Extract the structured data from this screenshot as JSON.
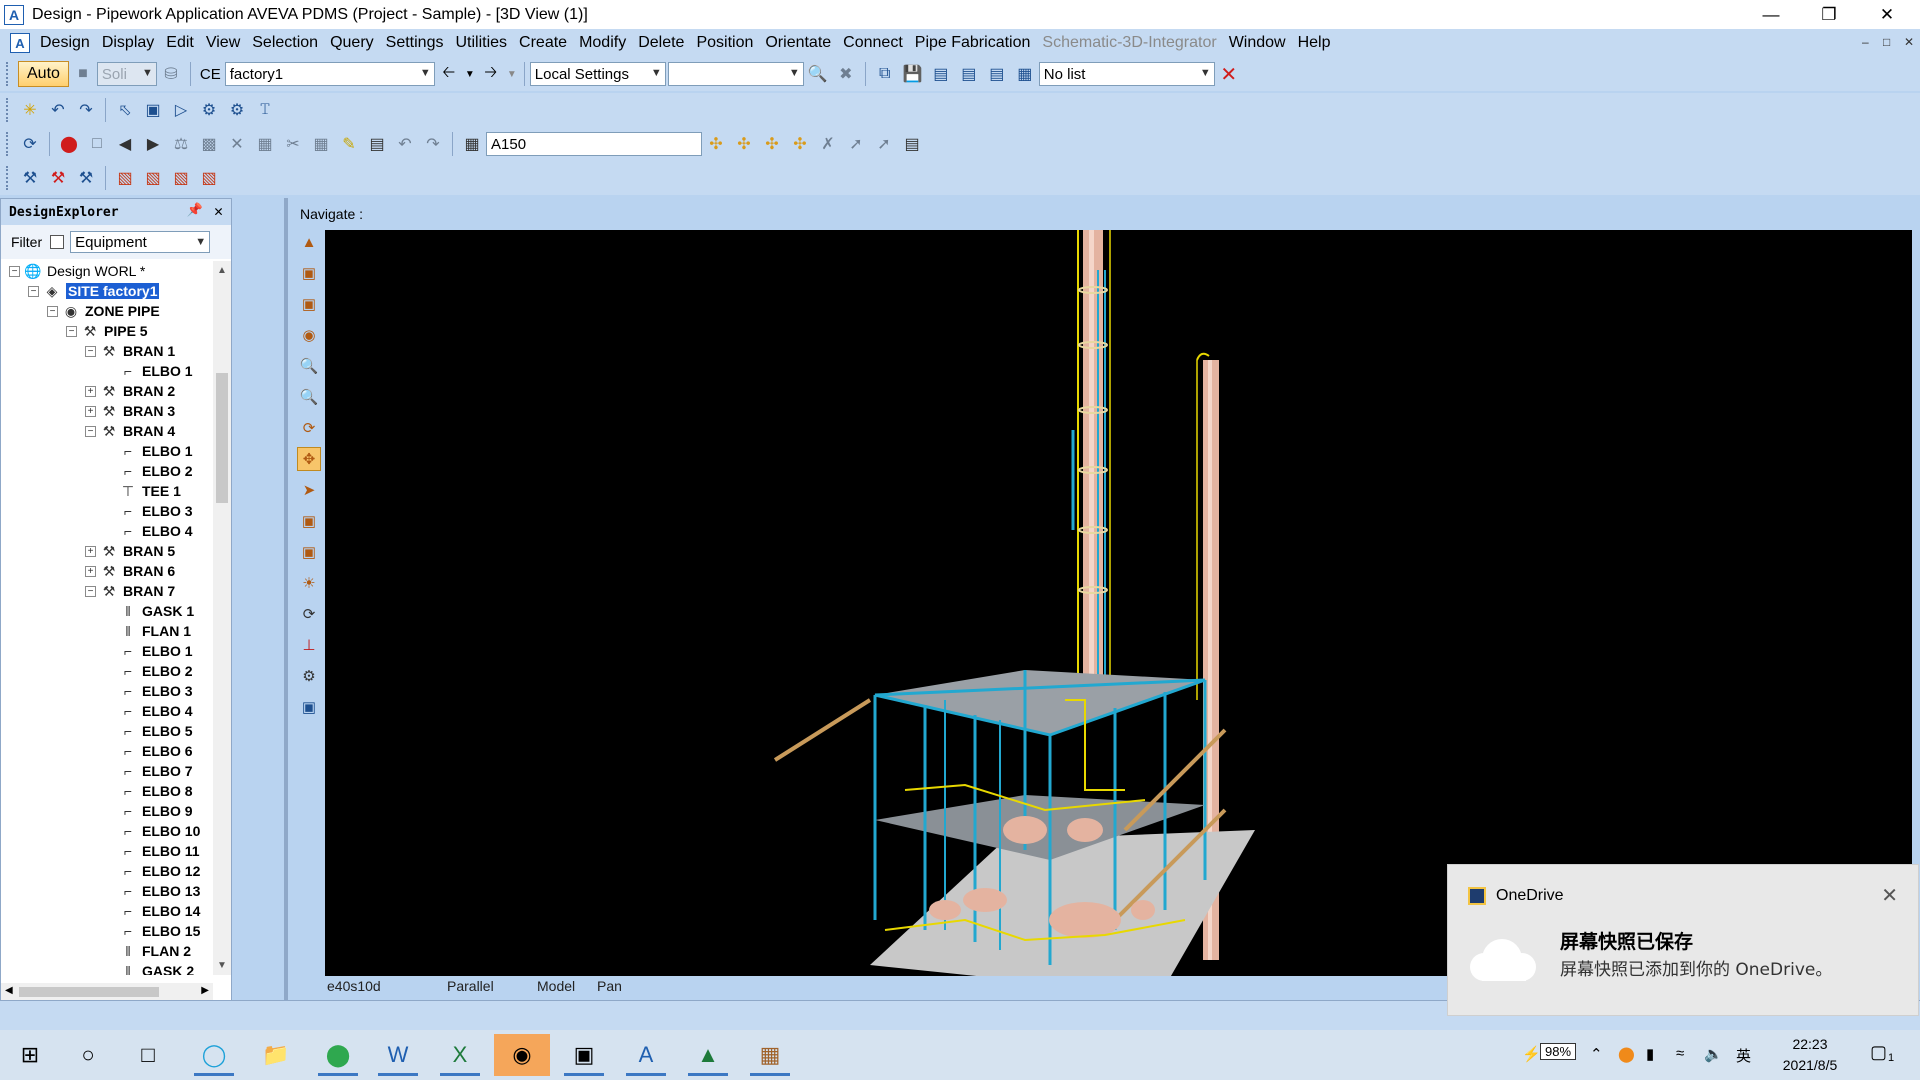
{
  "window": {
    "title": "Design - Pipework Application  AVEVA PDMS (Project - Sample) - [3D View (1)]",
    "app_icon": "A"
  },
  "menu": {
    "items": [
      "Design",
      "Display",
      "Edit",
      "View",
      "Selection",
      "Query",
      "Settings",
      "Utilities",
      "Create",
      "Modify",
      "Delete",
      "Position",
      "Orientate",
      "Connect",
      "Pipe Fabrication",
      "Schematic-3D-Integrator",
      "Window",
      "Help"
    ],
    "disabled_item": "Schematic-3D-Integrator"
  },
  "toolbar1": {
    "auto_label": "Auto",
    "solid_combo": "Soli",
    "ce_label": "CE",
    "ce_value": "factory1",
    "settings_combo": "Local Settings",
    "list_combo": "No list"
  },
  "toolbar3": {
    "spec_value": "A150"
  },
  "explorer": {
    "title": "DesignExplorer",
    "filter_label": "Filter",
    "filter_value": "Equipment",
    "tree": [
      {
        "label": "Design WORL *",
        "depth": 0,
        "expander": "minus",
        "icon": "globe-icon",
        "plain": true
      },
      {
        "label": "SITE factory1",
        "depth": 1,
        "expander": "minus",
        "icon": "site-icon",
        "selected": true
      },
      {
        "label": "ZONE PIPE",
        "depth": 2,
        "expander": "minus",
        "icon": "zone-icon"
      },
      {
        "label": "PIPE 5",
        "depth": 3,
        "expander": "minus",
        "icon": "pipe-icon"
      },
      {
        "label": "BRAN 1",
        "depth": 4,
        "expander": "minus",
        "icon": "branch-icon"
      },
      {
        "label": "ELBO 1",
        "depth": 5,
        "expander": "none",
        "icon": "elbow-icon"
      },
      {
        "label": "BRAN 2",
        "depth": 4,
        "expander": "plus",
        "icon": "branch-icon"
      },
      {
        "label": "BRAN 3",
        "depth": 4,
        "expander": "plus",
        "icon": "branch-icon"
      },
      {
        "label": "BRAN 4",
        "depth": 4,
        "expander": "minus",
        "icon": "branch-icon"
      },
      {
        "label": "ELBO 1",
        "depth": 5,
        "expander": "none",
        "icon": "elbow-icon"
      },
      {
        "label": "ELBO 2",
        "depth": 5,
        "expander": "none",
        "icon": "elbow-icon"
      },
      {
        "label": "TEE 1",
        "depth": 5,
        "expander": "none",
        "icon": "tee-icon"
      },
      {
        "label": "ELBO 3",
        "depth": 5,
        "expander": "none",
        "icon": "elbow-icon"
      },
      {
        "label": "ELBO 4",
        "depth": 5,
        "expander": "none",
        "icon": "elbow-icon"
      },
      {
        "label": "BRAN 5",
        "depth": 4,
        "expander": "plus",
        "icon": "branch-icon"
      },
      {
        "label": "BRAN 6",
        "depth": 4,
        "expander": "plus",
        "icon": "branch-icon"
      },
      {
        "label": "BRAN 7",
        "depth": 4,
        "expander": "minus",
        "icon": "branch-icon"
      },
      {
        "label": "GASK 1",
        "depth": 5,
        "expander": "none",
        "icon": "gasket-icon"
      },
      {
        "label": "FLAN 1",
        "depth": 5,
        "expander": "none",
        "icon": "flange-icon"
      },
      {
        "label": "ELBO 1",
        "depth": 5,
        "expander": "none",
        "icon": "elbow-icon"
      },
      {
        "label": "ELBO 2",
        "depth": 5,
        "expander": "none",
        "icon": "elbow-icon"
      },
      {
        "label": "ELBO 3",
        "depth": 5,
        "expander": "none",
        "icon": "elbow-icon"
      },
      {
        "label": "ELBO 4",
        "depth": 5,
        "expander": "none",
        "icon": "elbow-icon"
      },
      {
        "label": "ELBO 5",
        "depth": 5,
        "expander": "none",
        "icon": "elbow-icon"
      },
      {
        "label": "ELBO 6",
        "depth": 5,
        "expander": "none",
        "icon": "elbow-icon"
      },
      {
        "label": "ELBO 7",
        "depth": 5,
        "expander": "none",
        "icon": "elbow-icon"
      },
      {
        "label": "ELBO 8",
        "depth": 5,
        "expander": "none",
        "icon": "elbow-icon"
      },
      {
        "label": "ELBO 9",
        "depth": 5,
        "expander": "none",
        "icon": "elbow-icon"
      },
      {
        "label": "ELBO 10",
        "depth": 5,
        "expander": "none",
        "icon": "elbow-icon"
      },
      {
        "label": "ELBO 11",
        "depth": 5,
        "expander": "none",
        "icon": "elbow-icon"
      },
      {
        "label": "ELBO 12",
        "depth": 5,
        "expander": "none",
        "icon": "elbow-icon"
      },
      {
        "label": "ELBO 13",
        "depth": 5,
        "expander": "none",
        "icon": "elbow-icon"
      },
      {
        "label": "ELBO 14",
        "depth": 5,
        "expander": "none",
        "icon": "elbow-icon"
      },
      {
        "label": "ELBO 15",
        "depth": 5,
        "expander": "none",
        "icon": "elbow-icon"
      },
      {
        "label": "FLAN 2",
        "depth": 5,
        "expander": "none",
        "icon": "flange-icon"
      },
      {
        "label": "GASK 2",
        "depth": 5,
        "expander": "none",
        "icon": "gasket-icon"
      }
    ]
  },
  "view": {
    "navigate_label": "Navigate :",
    "status": {
      "view_code": "e40s10d",
      "projection": "Parallel",
      "mode": "Model",
      "action": "Pan"
    }
  },
  "toast": {
    "app": "OneDrive",
    "title": "屏幕快照已保存",
    "body": "屏幕快照已添加到你的 OneDrive。"
  },
  "taskbar": {
    "battery": "98%",
    "ime": "英",
    "time": "22:23",
    "date": "2021/8/5",
    "notifications": "1",
    "accent_active": "#f5a65a"
  }
}
